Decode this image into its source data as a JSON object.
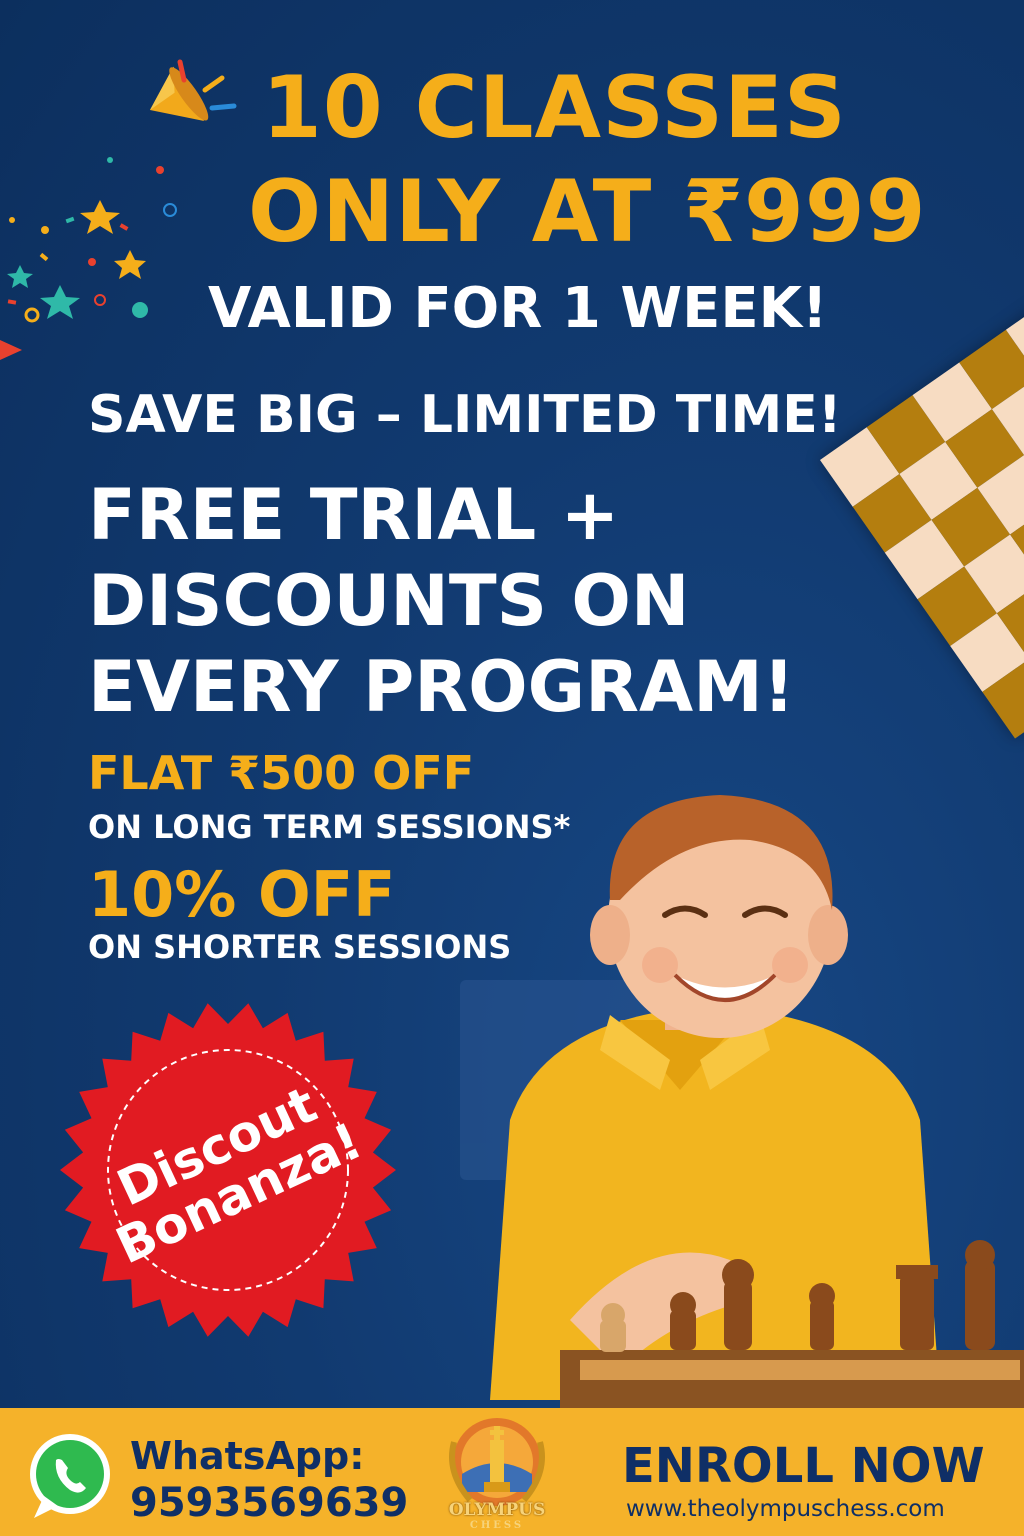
{
  "headline": {
    "line1": "10 CLASSES",
    "line2": "ONLY AT ₹999"
  },
  "validity": "VALID FOR 1 WEEK!",
  "save_line": "SAVE BIG – LIMITED TIME!",
  "free_trial": {
    "line1": "FREE TRIAL +",
    "line2": "DISCOUNTS ON",
    "line3": "EVERY PROGRAM!"
  },
  "offers": [
    {
      "title": "FLAT ₹500 OFF",
      "subtitle": "ON LONG TERM SESSIONS*"
    },
    {
      "title": "10% OFF",
      "subtitle": "ON SHORTER SESSIONS"
    }
  ],
  "badge": {
    "line1": "Discout",
    "line2": "Bonanza!",
    "color": "#e11b22"
  },
  "footer": {
    "whatsapp_label": "WhatsApp:",
    "whatsapp_number": "9593569639",
    "logo_line1": "OLYMPUS",
    "logo_line2": "CHESS",
    "cta": "ENROLL NOW",
    "website": "www.theolympuschess.com",
    "background": "#f5b22a"
  },
  "colors": {
    "background": "#0f3466",
    "accent_yellow": "#f5ae1a",
    "text_white": "#ffffff",
    "footer_text": "#0f2f66"
  },
  "icons": [
    "party-popper-icon",
    "whatsapp-icon",
    "chess-king-logo-icon"
  ]
}
